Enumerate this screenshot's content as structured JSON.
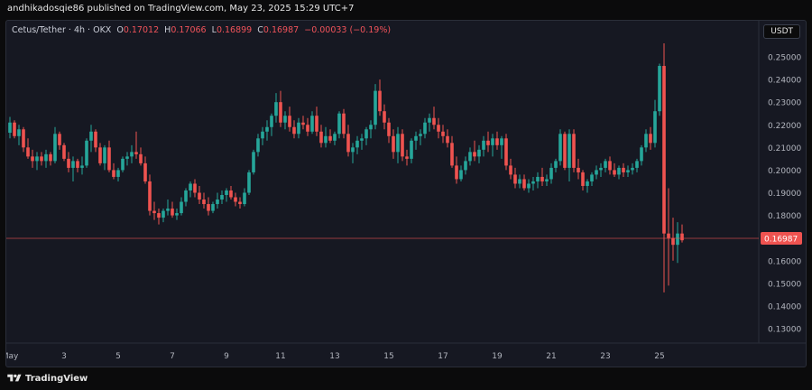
{
  "header": {
    "publish_text": "andhikadosqie86 published on TradingView.com, May 23, 2025 15:29 UTC+7"
  },
  "legend": {
    "symbol": "Cetus/Tether · 4h · OKX",
    "o_label": "O",
    "o_value": "0.17012",
    "h_label": "H",
    "h_value": "0.17066",
    "l_label": "L",
    "l_value": "0.16899",
    "c_label": "C",
    "c_value": "0.16987",
    "change": "−0.00033 (−0.19%)"
  },
  "currency_button": "USDT",
  "footer": {
    "brand": "TradingView"
  },
  "colors": {
    "up": "#26a69a",
    "down": "#ef5350",
    "background": "#161822",
    "axis_text": "#b2b5be",
    "price_line": "#ef5350"
  },
  "chart_data": {
    "type": "candlestick",
    "timeframe": "4h",
    "ylim": [
      0.12,
      0.26
    ],
    "price_scale_labels": [
      "0.25000",
      "0.24000",
      "0.23000",
      "0.22000",
      "0.21000",
      "0.20000",
      "0.19000",
      "0.18000",
      "0.17000",
      "0.16000",
      "0.15000",
      "0.14000",
      "0.13000"
    ],
    "x_tick_labels": [
      "May",
      "3",
      "5",
      "7",
      "9",
      "11",
      "13",
      "15",
      "17",
      "19",
      "21",
      "23",
      "25"
    ],
    "x_tick_positions": [
      0,
      12,
      24,
      36,
      48,
      60,
      72,
      84,
      96,
      108,
      120,
      132,
      144
    ],
    "last_price_label": "0.16987",
    "last_price": 0.16987,
    "candles": [
      {
        "o": 0.2165,
        "h": 0.2235,
        "l": 0.214,
        "c": 0.221
      },
      {
        "o": 0.221,
        "h": 0.222,
        "l": 0.214,
        "c": 0.215
      },
      {
        "o": 0.215,
        "h": 0.22,
        "l": 0.211,
        "c": 0.218
      },
      {
        "o": 0.218,
        "h": 0.219,
        "l": 0.208,
        "c": 0.21
      },
      {
        "o": 0.21,
        "h": 0.214,
        "l": 0.205,
        "c": 0.206
      },
      {
        "o": 0.206,
        "h": 0.209,
        "l": 0.201,
        "c": 0.204
      },
      {
        "o": 0.204,
        "h": 0.208,
        "l": 0.2,
        "c": 0.206
      },
      {
        "o": 0.206,
        "h": 0.208,
        "l": 0.202,
        "c": 0.204
      },
      {
        "o": 0.204,
        "h": 0.209,
        "l": 0.201,
        "c": 0.207
      },
      {
        "o": 0.207,
        "h": 0.208,
        "l": 0.202,
        "c": 0.204
      },
      {
        "o": 0.204,
        "h": 0.219,
        "l": 0.203,
        "c": 0.216
      },
      {
        "o": 0.216,
        "h": 0.217,
        "l": 0.209,
        "c": 0.211
      },
      {
        "o": 0.211,
        "h": 0.212,
        "l": 0.204,
        "c": 0.205
      },
      {
        "o": 0.205,
        "h": 0.208,
        "l": 0.199,
        "c": 0.201
      },
      {
        "o": 0.201,
        "h": 0.206,
        "l": 0.195,
        "c": 0.204
      },
      {
        "o": 0.204,
        "h": 0.205,
        "l": 0.199,
        "c": 0.201
      },
      {
        "o": 0.201,
        "h": 0.206,
        "l": 0.198,
        "c": 0.202
      },
      {
        "o": 0.202,
        "h": 0.214,
        "l": 0.201,
        "c": 0.213
      },
      {
        "o": 0.213,
        "h": 0.22,
        "l": 0.208,
        "c": 0.217
      },
      {
        "o": 0.217,
        "h": 0.218,
        "l": 0.208,
        "c": 0.21
      },
      {
        "o": 0.21,
        "h": 0.212,
        "l": 0.202,
        "c": 0.203
      },
      {
        "o": 0.203,
        "h": 0.211,
        "l": 0.2,
        "c": 0.21
      },
      {
        "o": 0.21,
        "h": 0.213,
        "l": 0.199,
        "c": 0.2
      },
      {
        "o": 0.2,
        "h": 0.203,
        "l": 0.196,
        "c": 0.197
      },
      {
        "o": 0.197,
        "h": 0.201,
        "l": 0.195,
        "c": 0.2
      },
      {
        "o": 0.2,
        "h": 0.206,
        "l": 0.199,
        "c": 0.205
      },
      {
        "o": 0.205,
        "h": 0.208,
        "l": 0.202,
        "c": 0.206
      },
      {
        "o": 0.206,
        "h": 0.211,
        "l": 0.203,
        "c": 0.208
      },
      {
        "o": 0.208,
        "h": 0.217,
        "l": 0.205,
        "c": 0.207
      },
      {
        "o": 0.207,
        "h": 0.21,
        "l": 0.202,
        "c": 0.203
      },
      {
        "o": 0.203,
        "h": 0.206,
        "l": 0.194,
        "c": 0.195
      },
      {
        "o": 0.195,
        "h": 0.198,
        "l": 0.18,
        "c": 0.182
      },
      {
        "o": 0.182,
        "h": 0.186,
        "l": 0.178,
        "c": 0.181
      },
      {
        "o": 0.181,
        "h": 0.183,
        "l": 0.176,
        "c": 0.179
      },
      {
        "o": 0.179,
        "h": 0.183,
        "l": 0.177,
        "c": 0.182
      },
      {
        "o": 0.182,
        "h": 0.187,
        "l": 0.18,
        "c": 0.183
      },
      {
        "o": 0.183,
        "h": 0.186,
        "l": 0.179,
        "c": 0.18
      },
      {
        "o": 0.18,
        "h": 0.183,
        "l": 0.178,
        "c": 0.181
      },
      {
        "o": 0.181,
        "h": 0.188,
        "l": 0.18,
        "c": 0.186
      },
      {
        "o": 0.186,
        "h": 0.192,
        "l": 0.184,
        "c": 0.191
      },
      {
        "o": 0.191,
        "h": 0.195,
        "l": 0.188,
        "c": 0.194
      },
      {
        "o": 0.194,
        "h": 0.196,
        "l": 0.188,
        "c": 0.19
      },
      {
        "o": 0.19,
        "h": 0.193,
        "l": 0.185,
        "c": 0.187
      },
      {
        "o": 0.187,
        "h": 0.19,
        "l": 0.183,
        "c": 0.185
      },
      {
        "o": 0.185,
        "h": 0.188,
        "l": 0.18,
        "c": 0.182
      },
      {
        "o": 0.182,
        "h": 0.186,
        "l": 0.181,
        "c": 0.185
      },
      {
        "o": 0.185,
        "h": 0.19,
        "l": 0.183,
        "c": 0.187
      },
      {
        "o": 0.187,
        "h": 0.191,
        "l": 0.185,
        "c": 0.189
      },
      {
        "o": 0.189,
        "h": 0.192,
        "l": 0.186,
        "c": 0.191
      },
      {
        "o": 0.191,
        "h": 0.193,
        "l": 0.187,
        "c": 0.188
      },
      {
        "o": 0.188,
        "h": 0.19,
        "l": 0.184,
        "c": 0.186
      },
      {
        "o": 0.186,
        "h": 0.188,
        "l": 0.183,
        "c": 0.185
      },
      {
        "o": 0.185,
        "h": 0.192,
        "l": 0.184,
        "c": 0.19
      },
      {
        "o": 0.19,
        "h": 0.2,
        "l": 0.189,
        "c": 0.199
      },
      {
        "o": 0.199,
        "h": 0.209,
        "l": 0.198,
        "c": 0.208
      },
      {
        "o": 0.208,
        "h": 0.216,
        "l": 0.206,
        "c": 0.214
      },
      {
        "o": 0.214,
        "h": 0.219,
        "l": 0.211,
        "c": 0.217
      },
      {
        "o": 0.217,
        "h": 0.222,
        "l": 0.213,
        "c": 0.219
      },
      {
        "o": 0.219,
        "h": 0.225,
        "l": 0.215,
        "c": 0.224
      },
      {
        "o": 0.224,
        "h": 0.234,
        "l": 0.221,
        "c": 0.23
      },
      {
        "o": 0.23,
        "h": 0.235,
        "l": 0.219,
        "c": 0.221
      },
      {
        "o": 0.221,
        "h": 0.226,
        "l": 0.218,
        "c": 0.224
      },
      {
        "o": 0.224,
        "h": 0.228,
        "l": 0.217,
        "c": 0.219
      },
      {
        "o": 0.219,
        "h": 0.222,
        "l": 0.214,
        "c": 0.216
      },
      {
        "o": 0.216,
        "h": 0.223,
        "l": 0.214,
        "c": 0.221
      },
      {
        "o": 0.221,
        "h": 0.224,
        "l": 0.218,
        "c": 0.22
      },
      {
        "o": 0.22,
        "h": 0.223,
        "l": 0.215,
        "c": 0.217
      },
      {
        "o": 0.217,
        "h": 0.226,
        "l": 0.216,
        "c": 0.224
      },
      {
        "o": 0.224,
        "h": 0.228,
        "l": 0.215,
        "c": 0.217
      },
      {
        "o": 0.217,
        "h": 0.22,
        "l": 0.21,
        "c": 0.212
      },
      {
        "o": 0.212,
        "h": 0.219,
        "l": 0.21,
        "c": 0.215
      },
      {
        "o": 0.215,
        "h": 0.218,
        "l": 0.212,
        "c": 0.213
      },
      {
        "o": 0.213,
        "h": 0.217,
        "l": 0.211,
        "c": 0.216
      },
      {
        "o": 0.216,
        "h": 0.226,
        "l": 0.214,
        "c": 0.225
      },
      {
        "o": 0.225,
        "h": 0.227,
        "l": 0.214,
        "c": 0.216
      },
      {
        "o": 0.216,
        "h": 0.22,
        "l": 0.206,
        "c": 0.208
      },
      {
        "o": 0.208,
        "h": 0.212,
        "l": 0.203,
        "c": 0.21
      },
      {
        "o": 0.21,
        "h": 0.215,
        "l": 0.207,
        "c": 0.213
      },
      {
        "o": 0.213,
        "h": 0.216,
        "l": 0.209,
        "c": 0.214
      },
      {
        "o": 0.214,
        "h": 0.219,
        "l": 0.211,
        "c": 0.218
      },
      {
        "o": 0.218,
        "h": 0.222,
        "l": 0.214,
        "c": 0.22
      },
      {
        "o": 0.22,
        "h": 0.238,
        "l": 0.218,
        "c": 0.235
      },
      {
        "o": 0.235,
        "h": 0.24,
        "l": 0.224,
        "c": 0.226
      },
      {
        "o": 0.226,
        "h": 0.229,
        "l": 0.218,
        "c": 0.221
      },
      {
        "o": 0.221,
        "h": 0.223,
        "l": 0.212,
        "c": 0.215
      },
      {
        "o": 0.215,
        "h": 0.218,
        "l": 0.205,
        "c": 0.208
      },
      {
        "o": 0.208,
        "h": 0.219,
        "l": 0.203,
        "c": 0.216
      },
      {
        "o": 0.216,
        "h": 0.218,
        "l": 0.204,
        "c": 0.206
      },
      {
        "o": 0.206,
        "h": 0.209,
        "l": 0.202,
        "c": 0.205
      },
      {
        "o": 0.205,
        "h": 0.214,
        "l": 0.203,
        "c": 0.213
      },
      {
        "o": 0.213,
        "h": 0.217,
        "l": 0.209,
        "c": 0.215
      },
      {
        "o": 0.215,
        "h": 0.218,
        "l": 0.211,
        "c": 0.216
      },
      {
        "o": 0.216,
        "h": 0.223,
        "l": 0.214,
        "c": 0.221
      },
      {
        "o": 0.221,
        "h": 0.225,
        "l": 0.217,
        "c": 0.223
      },
      {
        "o": 0.223,
        "h": 0.228,
        "l": 0.218,
        "c": 0.22
      },
      {
        "o": 0.22,
        "h": 0.223,
        "l": 0.214,
        "c": 0.217
      },
      {
        "o": 0.217,
        "h": 0.22,
        "l": 0.212,
        "c": 0.215
      },
      {
        "o": 0.215,
        "h": 0.218,
        "l": 0.21,
        "c": 0.212
      },
      {
        "o": 0.212,
        "h": 0.215,
        "l": 0.201,
        "c": 0.202
      },
      {
        "o": 0.202,
        "h": 0.206,
        "l": 0.194,
        "c": 0.196
      },
      {
        "o": 0.196,
        "h": 0.202,
        "l": 0.195,
        "c": 0.2
      },
      {
        "o": 0.2,
        "h": 0.206,
        "l": 0.198,
        "c": 0.204
      },
      {
        "o": 0.204,
        "h": 0.21,
        "l": 0.202,
        "c": 0.208
      },
      {
        "o": 0.208,
        "h": 0.213,
        "l": 0.204,
        "c": 0.206
      },
      {
        "o": 0.206,
        "h": 0.211,
        "l": 0.203,
        "c": 0.209
      },
      {
        "o": 0.209,
        "h": 0.215,
        "l": 0.206,
        "c": 0.213
      },
      {
        "o": 0.213,
        "h": 0.217,
        "l": 0.208,
        "c": 0.211
      },
      {
        "o": 0.211,
        "h": 0.216,
        "l": 0.206,
        "c": 0.214
      },
      {
        "o": 0.214,
        "h": 0.217,
        "l": 0.209,
        "c": 0.211
      },
      {
        "o": 0.211,
        "h": 0.215,
        "l": 0.205,
        "c": 0.214
      },
      {
        "o": 0.214,
        "h": 0.216,
        "l": 0.2,
        "c": 0.202
      },
      {
        "o": 0.202,
        "h": 0.205,
        "l": 0.196,
        "c": 0.198
      },
      {
        "o": 0.198,
        "h": 0.201,
        "l": 0.192,
        "c": 0.194
      },
      {
        "o": 0.194,
        "h": 0.198,
        "l": 0.192,
        "c": 0.196
      },
      {
        "o": 0.196,
        "h": 0.198,
        "l": 0.191,
        "c": 0.192
      },
      {
        "o": 0.192,
        "h": 0.196,
        "l": 0.19,
        "c": 0.194
      },
      {
        "o": 0.194,
        "h": 0.197,
        "l": 0.191,
        "c": 0.195
      },
      {
        "o": 0.195,
        "h": 0.199,
        "l": 0.192,
        "c": 0.197
      },
      {
        "o": 0.197,
        "h": 0.201,
        "l": 0.193,
        "c": 0.195
      },
      {
        "o": 0.195,
        "h": 0.198,
        "l": 0.193,
        "c": 0.196
      },
      {
        "o": 0.196,
        "h": 0.203,
        "l": 0.194,
        "c": 0.201
      },
      {
        "o": 0.201,
        "h": 0.205,
        "l": 0.199,
        "c": 0.204
      },
      {
        "o": 0.204,
        "h": 0.218,
        "l": 0.202,
        "c": 0.216
      },
      {
        "o": 0.216,
        "h": 0.217,
        "l": 0.2,
        "c": 0.201
      },
      {
        "o": 0.201,
        "h": 0.218,
        "l": 0.195,
        "c": 0.216
      },
      {
        "o": 0.216,
        "h": 0.218,
        "l": 0.199,
        "c": 0.201
      },
      {
        "o": 0.201,
        "h": 0.205,
        "l": 0.196,
        "c": 0.199
      },
      {
        "o": 0.199,
        "h": 0.2,
        "l": 0.191,
        "c": 0.193
      },
      {
        "o": 0.193,
        "h": 0.196,
        "l": 0.19,
        "c": 0.195
      },
      {
        "o": 0.195,
        "h": 0.199,
        "l": 0.193,
        "c": 0.198
      },
      {
        "o": 0.198,
        "h": 0.202,
        "l": 0.196,
        "c": 0.2
      },
      {
        "o": 0.2,
        "h": 0.203,
        "l": 0.197,
        "c": 0.201
      },
      {
        "o": 0.201,
        "h": 0.205,
        "l": 0.199,
        "c": 0.204
      },
      {
        "o": 0.204,
        "h": 0.206,
        "l": 0.198,
        "c": 0.2
      },
      {
        "o": 0.2,
        "h": 0.203,
        "l": 0.197,
        "c": 0.198
      },
      {
        "o": 0.198,
        "h": 0.202,
        "l": 0.196,
        "c": 0.201
      },
      {
        "o": 0.201,
        "h": 0.203,
        "l": 0.197,
        "c": 0.199
      },
      {
        "o": 0.199,
        "h": 0.202,
        "l": 0.197,
        "c": 0.2
      },
      {
        "o": 0.2,
        "h": 0.203,
        "l": 0.198,
        "c": 0.201
      },
      {
        "o": 0.201,
        "h": 0.205,
        "l": 0.199,
        "c": 0.204
      },
      {
        "o": 0.204,
        "h": 0.211,
        "l": 0.202,
        "c": 0.21
      },
      {
        "o": 0.21,
        "h": 0.218,
        "l": 0.208,
        "c": 0.216
      },
      {
        "o": 0.216,
        "h": 0.219,
        "l": 0.209,
        "c": 0.212
      },
      {
        "o": 0.212,
        "h": 0.231,
        "l": 0.21,
        "c": 0.226
      },
      {
        "o": 0.226,
        "h": 0.247,
        "l": 0.224,
        "c": 0.246
      },
      {
        "o": 0.246,
        "h": 0.256,
        "l": 0.146,
        "c": 0.172
      },
      {
        "o": 0.172,
        "h": 0.192,
        "l": 0.149,
        "c": 0.17
      },
      {
        "o": 0.17,
        "h": 0.179,
        "l": 0.16,
        "c": 0.167
      },
      {
        "o": 0.167,
        "h": 0.177,
        "l": 0.159,
        "c": 0.172
      },
      {
        "o": 0.172,
        "h": 0.176,
        "l": 0.168,
        "c": 0.169
      }
    ]
  }
}
